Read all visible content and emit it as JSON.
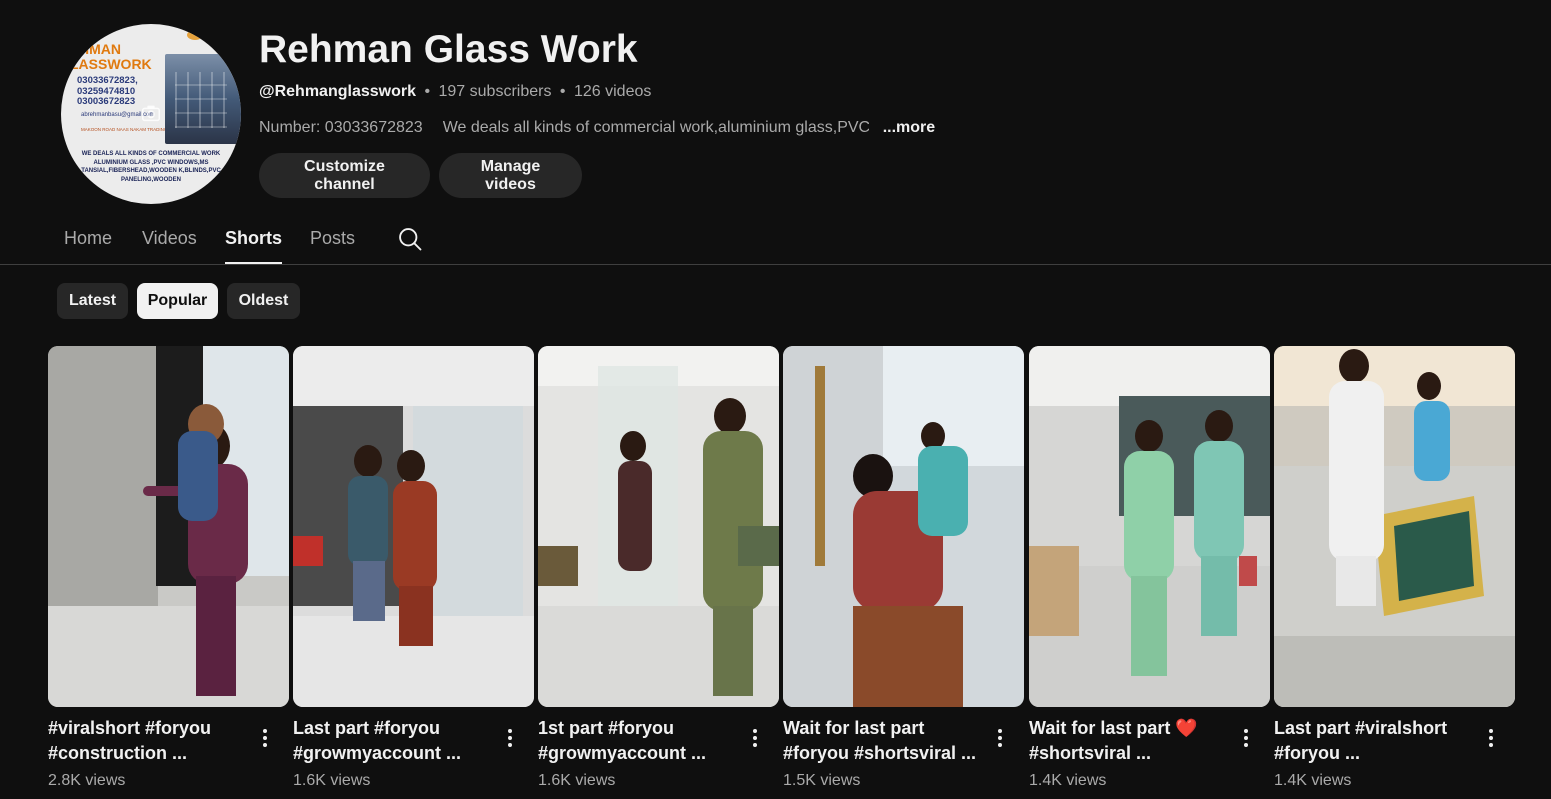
{
  "channel": {
    "title": "Rehman Glass Work",
    "handle": "@Rehmanglasswork",
    "subscribers": "197 subscribers",
    "videos_count": "126 videos",
    "meta_separator": "•",
    "number": "Number: 03033672823",
    "description": "We deals all kinds of commercial work,aluminium glass,PVC",
    "more_label": "...more",
    "avatar": {
      "logo_line1": "HMAN",
      "logo_line2": "LASSWORK",
      "phones": [
        "03033672823,",
        "03259474810",
        "03003672823"
      ],
      "email": "abrehmanbasu@gmail.com",
      "address": "MAKOON ROAD NAAS NAKAM TRADING LAHORE",
      "desc": "WE DEALS ALL KINDS OF COMMERCIAL WORK ALUMINIUM GLASS ,PVC WINDOWS,MS TANSIAL,FIBERSHEAD,WOODEN K,BLINDS,PVC PANELING,WOODEN"
    }
  },
  "buttons": {
    "customize": "Customize channel",
    "manage": "Manage videos"
  },
  "tabs": [
    {
      "label": "Home"
    },
    {
      "label": "Videos"
    },
    {
      "label": "Shorts"
    },
    {
      "label": "Posts"
    }
  ],
  "sort_chips": [
    {
      "label": "Latest"
    },
    {
      "label": "Popular"
    },
    {
      "label": "Oldest"
    }
  ],
  "shorts": [
    {
      "title_line1": "#viralshort #foryou",
      "title_line2": "#construction ...",
      "views": "2.8K views"
    },
    {
      "title_line1": "Last part #foryou",
      "title_line2": "#growmyaccount ...",
      "views": "1.6K views"
    },
    {
      "title_line1": "1st part #foryou",
      "title_line2": "#growmyaccount ...",
      "views": "1.6K views"
    },
    {
      "title_line1": "Wait for last part",
      "title_line2": "#foryou #shortsviral ...",
      "views": "1.5K views"
    },
    {
      "title_line1": "Wait for last part",
      "title_line1_emoji": "❤️",
      "title_line2": "#shortsviral ...",
      "views": "1.4K views"
    },
    {
      "title_line1": "Last part #viralshort",
      "title_line2": "#foryou ...",
      "views": "1.4K views"
    }
  ],
  "colors": {
    "background": "#0f0f0f",
    "chip_bg": "#272727",
    "chip_selected_bg": "#f1f1f1",
    "text_primary": "#f1f1f1",
    "text_secondary": "#aaaaaa",
    "logo_orange": "#e07a10"
  },
  "icons": {
    "search": "search-icon",
    "more": "more-vert-icon",
    "camera": "camera-icon"
  }
}
